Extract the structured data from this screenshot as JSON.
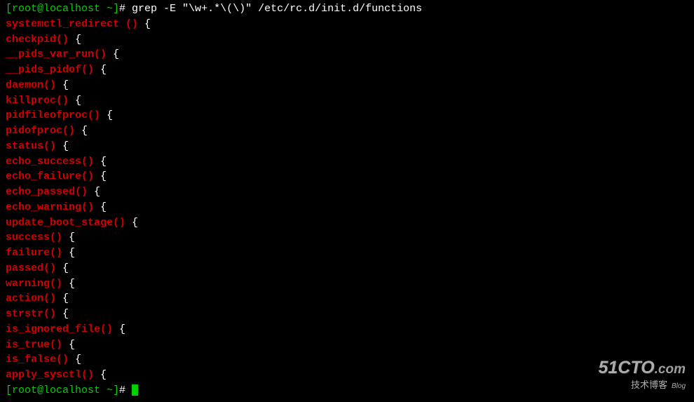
{
  "prompt": {
    "user_host": "[root@localhost ~]",
    "hash": "# "
  },
  "command": "grep -E \"\\w+.*\\(\\)\" /etc/rc.d/init.d/functions",
  "output_lines": [
    {
      "match": "systemctl_redirect ()",
      "rest": " {"
    },
    {
      "match": "checkpid()",
      "rest": " {"
    },
    {
      "match": "__pids_var_run()",
      "rest": " {"
    },
    {
      "match": "__pids_pidof()",
      "rest": " {"
    },
    {
      "match": "daemon()",
      "rest": " {"
    },
    {
      "match": "killproc()",
      "rest": " {"
    },
    {
      "match": "pidfileofproc()",
      "rest": " {"
    },
    {
      "match": "pidofproc()",
      "rest": " {"
    },
    {
      "match": "status()",
      "rest": " {"
    },
    {
      "match": "echo_success()",
      "rest": " {"
    },
    {
      "match": "echo_failure()",
      "rest": " {"
    },
    {
      "match": "echo_passed()",
      "rest": " {"
    },
    {
      "match": "echo_warning()",
      "rest": " {"
    },
    {
      "match": "update_boot_stage()",
      "rest": " {"
    },
    {
      "match": "success()",
      "rest": " {"
    },
    {
      "match": "failure()",
      "rest": " {"
    },
    {
      "match": "passed()",
      "rest": " {"
    },
    {
      "match": "warning()",
      "rest": " {"
    },
    {
      "match": "action()",
      "rest": " {"
    },
    {
      "match": "strstr()",
      "rest": " {"
    },
    {
      "match": "is_ignored_file()",
      "rest": " {"
    },
    {
      "match": "is_true()",
      "rest": " {"
    },
    {
      "match": "is_false()",
      "rest": " {"
    },
    {
      "match": "apply_sysctl()",
      "rest": " {"
    }
  ],
  "watermark": {
    "main": "51CTO",
    "suffix": ".com",
    "sub": "技术博客",
    "blog": "Blog"
  }
}
